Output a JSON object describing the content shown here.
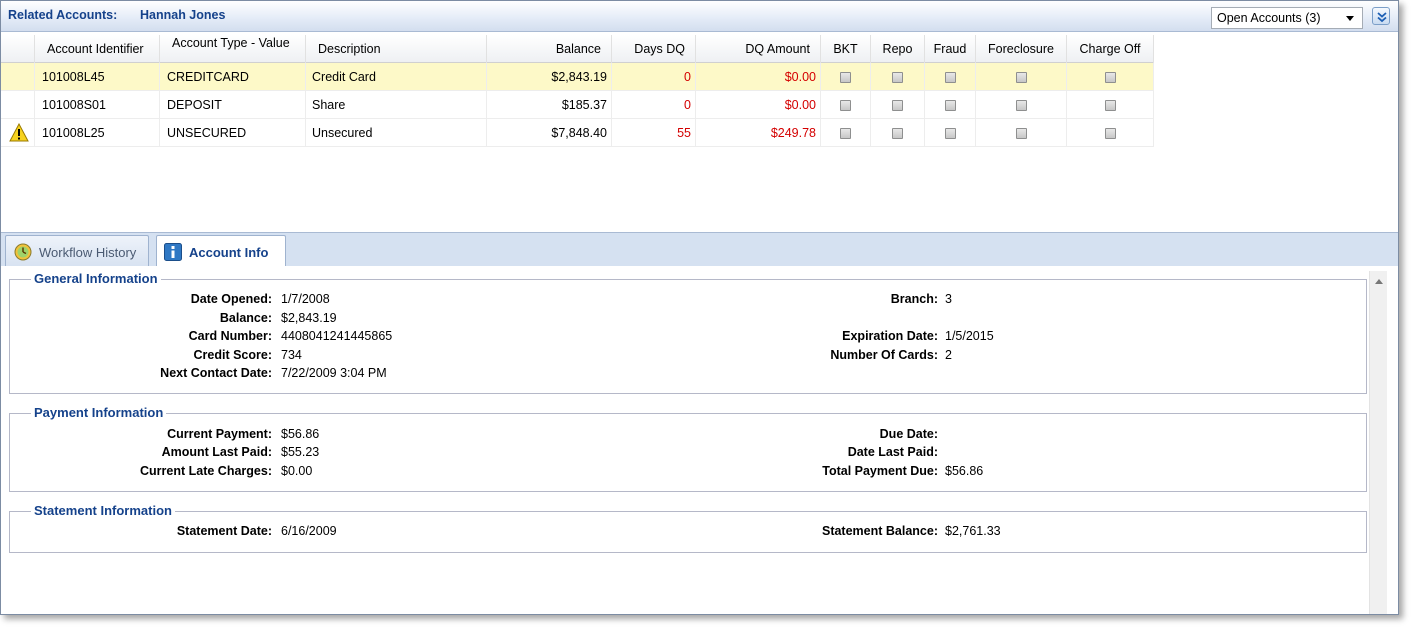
{
  "header": {
    "label": "Related Accounts:",
    "name": "Hannah Jones",
    "filter_value": "Open Accounts (3)"
  },
  "grid": {
    "columns": [
      "Account Identifier",
      "Account Type - Value",
      "Description",
      "Balance",
      "Days DQ",
      "DQ Amount",
      "BKT",
      "Repo",
      "Fraud",
      "Foreclosure",
      "Charge Off"
    ],
    "rows": [
      {
        "warning": false,
        "id": "101008L45",
        "type": "CREDITCARD",
        "description": "Credit Card",
        "balance": "$2,843.19",
        "days_dq": "0",
        "dq_amount": "$0.00",
        "selected": true
      },
      {
        "warning": false,
        "id": "101008S01",
        "type": "DEPOSIT",
        "description": "Share",
        "balance": "$185.37",
        "days_dq": "0",
        "dq_amount": "$0.00",
        "selected": false
      },
      {
        "warning": true,
        "id": "101008L25",
        "type": "UNSECURED",
        "description": "Unsecured",
        "balance": "$7,848.40",
        "days_dq": "55",
        "dq_amount": "$249.78",
        "selected": false
      }
    ]
  },
  "tabs": [
    {
      "label": "Workflow History",
      "icon": "workflow-history-icon",
      "active": false
    },
    {
      "label": "Account Info",
      "icon": "info-icon",
      "active": true
    }
  ],
  "general": {
    "title": "General Information",
    "date_opened_label": "Date Opened:",
    "date_opened": "1/7/2008",
    "balance_label": "Balance:",
    "balance": "$2,843.19",
    "card_number_label": "Card Number:",
    "card_number": "4408041241445865",
    "credit_score_label": "Credit Score:",
    "credit_score": "734",
    "next_contact_label": "Next Contact Date:",
    "next_contact": "7/22/2009 3:04 PM",
    "branch_label": "Branch:",
    "branch": "3",
    "expiration_label": "Expiration Date:",
    "expiration": "1/5/2015",
    "num_cards_label": "Number Of Cards:",
    "num_cards": "2"
  },
  "payment": {
    "title": "Payment Information",
    "current_payment_label": "Current Payment:",
    "current_payment": "$56.86",
    "amount_last_paid_label": "Amount Last Paid:",
    "amount_last_paid": "$55.23",
    "late_charges_label": "Current Late Charges:",
    "late_charges": "$0.00",
    "due_date_label": "Due Date:",
    "due_date": "",
    "date_last_paid_label": "Date Last Paid:",
    "date_last_paid": "",
    "total_due_label": "Total Payment Due:",
    "total_due": "$56.86"
  },
  "statement": {
    "title": "Statement Information",
    "statement_date_label": "Statement Date:",
    "statement_date": "6/16/2009",
    "statement_balance_label": "Statement Balance:",
    "statement_balance": "$2,761.33"
  },
  "colors": {
    "accent": "#15428b",
    "alert": "#d40000",
    "selected_row": "#fdf9c8"
  }
}
